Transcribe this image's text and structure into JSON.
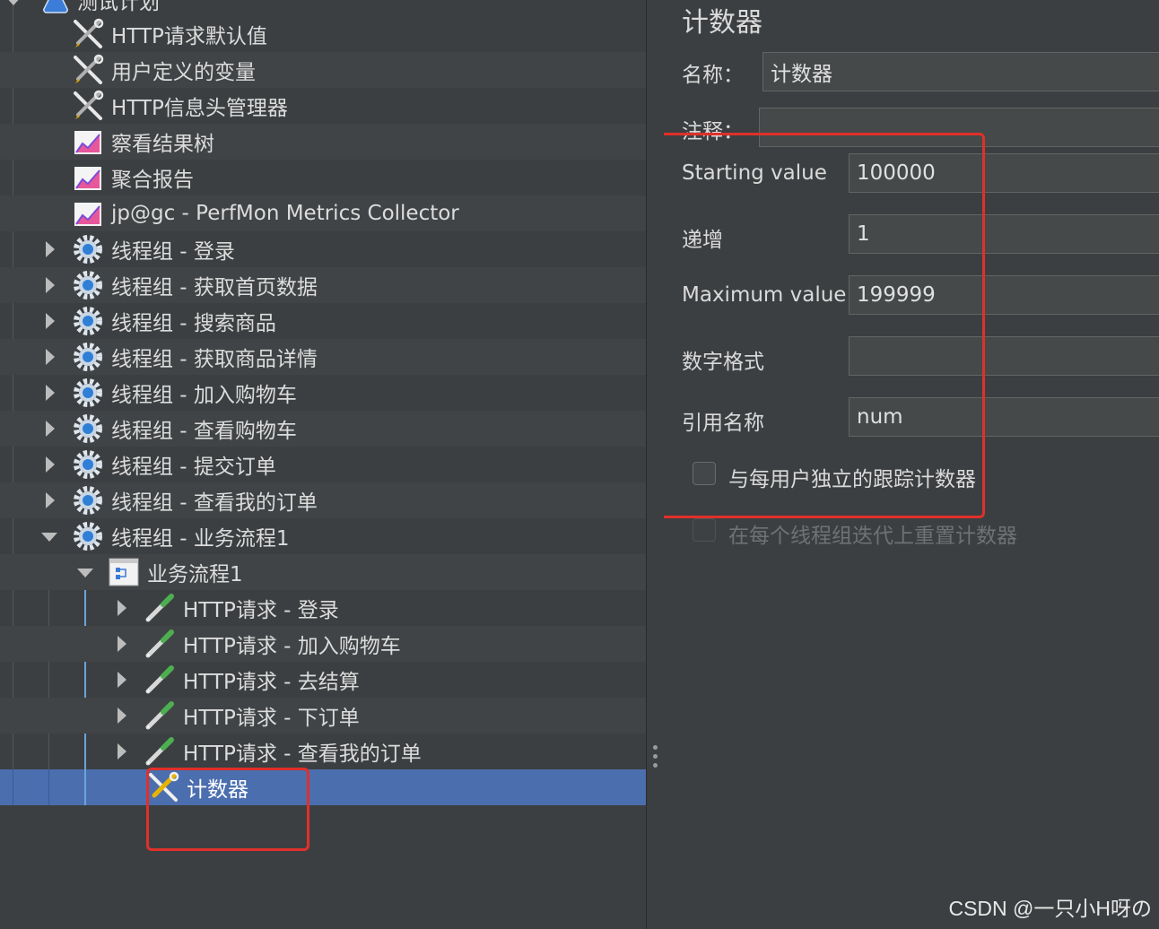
{
  "tree": {
    "root_label": "测试计划",
    "items": [
      {
        "label": "HTTP请求默认值",
        "icon": "config-element-icon"
      },
      {
        "label": "用户定义的变量",
        "icon": "config-element-icon"
      },
      {
        "label": "HTTP信息头管理器",
        "icon": "config-element-icon"
      },
      {
        "label": "察看结果树",
        "icon": "listener-icon"
      },
      {
        "label": "聚合报告",
        "icon": "listener-icon"
      },
      {
        "label": "jp@gc - PerfMon Metrics Collector",
        "icon": "listener-icon"
      },
      {
        "label": "线程组 - 登录",
        "icon": "thread-group-icon"
      },
      {
        "label": "线程组 - 获取首页数据",
        "icon": "thread-group-icon"
      },
      {
        "label": "线程组 - 搜索商品",
        "icon": "thread-group-icon"
      },
      {
        "label": "线程组 - 获取商品详情",
        "icon": "thread-group-icon"
      },
      {
        "label": "线程组 - 加入购物车",
        "icon": "thread-group-icon"
      },
      {
        "label": "线程组 - 查看购物车",
        "icon": "thread-group-icon"
      },
      {
        "label": "线程组 - 提交订单",
        "icon": "thread-group-icon"
      },
      {
        "label": "线程组 - 查看我的订单",
        "icon": "thread-group-icon"
      },
      {
        "label": "线程组 - 业务流程1",
        "icon": "thread-group-icon"
      },
      {
        "label": "业务流程1",
        "icon": "transaction-controller-icon"
      },
      {
        "label": "HTTP请求 - 登录",
        "icon": "sampler-icon"
      },
      {
        "label": "HTTP请求 - 加入购物车",
        "icon": "sampler-icon"
      },
      {
        "label": "HTTP请求 - 去结算",
        "icon": "sampler-icon"
      },
      {
        "label": "HTTP请求 - 下订单",
        "icon": "sampler-icon"
      },
      {
        "label": "HTTP请求 - 查看我的订单",
        "icon": "sampler-icon"
      },
      {
        "label": "计数器",
        "icon": "counter-icon"
      }
    ]
  },
  "panel": {
    "title": "计数器",
    "name_label": "名称：",
    "name_value": "计数器",
    "comment_label": "注释：",
    "comment_value": "",
    "starting_label": "Starting value",
    "starting_value": "100000",
    "increment_label": "递增",
    "increment_value": "1",
    "max_label": "Maximum value",
    "max_value": "199999",
    "format_label": "数字格式",
    "format_value": "",
    "ref_label": "引用名称",
    "ref_value": "num",
    "per_user_label": "与每用户独立的跟踪计数器",
    "reset_label": "在每个线程组迭代上重置计数器"
  },
  "watermark": "CSDN @一只小H呀の",
  "colors": {
    "background": "#3c3f41",
    "selection": "#4b6eaf",
    "highlight_box": "#e0302a"
  }
}
